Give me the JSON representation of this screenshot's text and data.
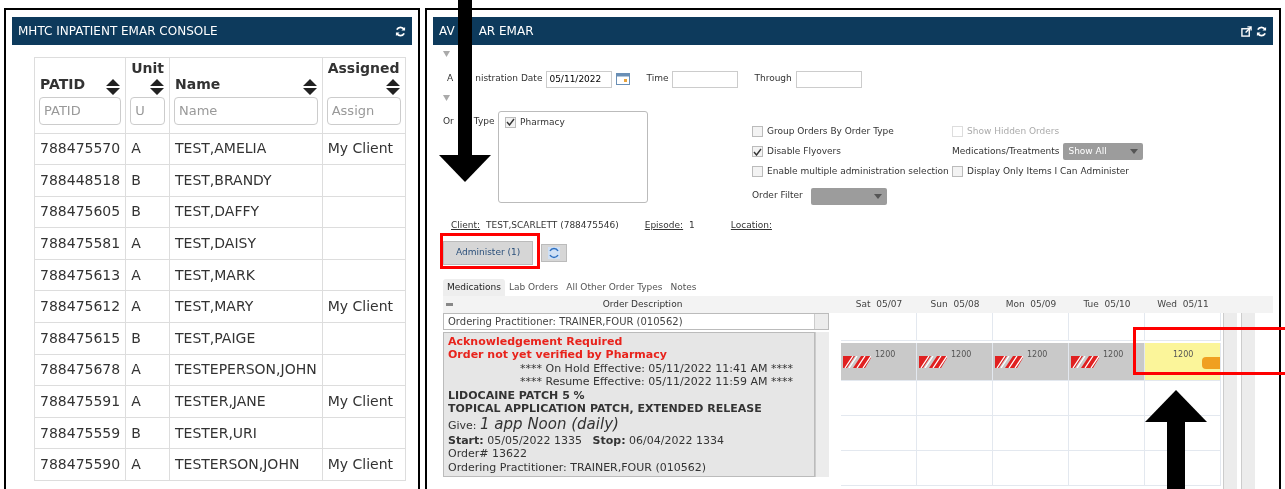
{
  "left_panel": {
    "title": "MHTC INPATIENT EMAR CONSOLE",
    "columns": [
      {
        "label": "PATID",
        "placeholder": "PATID"
      },
      {
        "label": "Unit",
        "placeholder": "U"
      },
      {
        "label": "Name",
        "placeholder": "Name"
      },
      {
        "label": "Assigned",
        "placeholder": "Assign"
      }
    ],
    "rows": [
      [
        "788475570",
        "A",
        "TEST,AMELIA",
        "My Client"
      ],
      [
        "788448518",
        "B",
        "TEST,BRANDY",
        ""
      ],
      [
        "788475605",
        "B",
        "TEST,DAFFY",
        ""
      ],
      [
        "788475581",
        "A",
        "TEST,DAISY",
        ""
      ],
      [
        "788475613",
        "A",
        "TEST,MARK",
        ""
      ],
      [
        "788475612",
        "A",
        "TEST,MARY",
        "My Client"
      ],
      [
        "788475615",
        "B",
        "TEST,PAIGE",
        ""
      ],
      [
        "788475678",
        "A",
        "TESTEPERSON,JOHN",
        ""
      ],
      [
        "788475591",
        "A",
        "TESTER,JANE",
        "My Client"
      ],
      [
        "788475559",
        "B",
        "TESTER,URI",
        ""
      ],
      [
        "788475590",
        "A",
        "TESTERSON,JOHN",
        "My Client"
      ]
    ]
  },
  "right_panel": {
    "title_parts": [
      "AV",
      "AR EMAR"
    ],
    "admin_date_label_parts": [
      "A",
      "nistration Date"
    ],
    "admin_date": "05/11/2022",
    "time_label": "Time",
    "through_label": "Through",
    "order_type_label_parts": [
      "Or",
      "Type"
    ],
    "order_types": [
      {
        "label": "Pharmacy",
        "checked": true
      }
    ],
    "options": [
      {
        "label": "Group Orders By Order Type",
        "checked": false,
        "disabled": false
      },
      {
        "label": "Show Hidden Orders",
        "checked": false,
        "disabled": true
      },
      {
        "label": "Disable Flyovers",
        "checked": true,
        "disabled": false
      },
      {
        "label": "Enable multiple administration selection",
        "checked": false,
        "disabled": false
      },
      {
        "label": "Display Only Items I Can Administer",
        "checked": false,
        "disabled": false
      }
    ],
    "med_treat_label": "Medications/Treatments",
    "med_treat_value": "Show All",
    "order_filter_label": "Order Filter",
    "client_label": "Client:",
    "client": "TEST,SCARLETT (788475546)",
    "episode_label": "Episode:",
    "episode": "1",
    "location_label": "Location:",
    "administer_button": "Administer (1)",
    "tabs": [
      {
        "label": "Medications",
        "selected": true
      },
      {
        "label": "Lab Orders",
        "selected": false
      },
      {
        "label": "All Other Order Types",
        "selected": false
      },
      {
        "label": "Notes",
        "selected": false
      }
    ],
    "description_header": "Order Description",
    "days": [
      "Sat  05/07",
      "Sun  05/08",
      "Mon  05/09",
      "Tue  05/10",
      "Wed  05/11"
    ],
    "previous_order_line": "Ordering Practitioner: TRAINER,FOUR (010562)",
    "order_lines": [
      {
        "kind": "alert",
        "text": "Acknowledgement Required"
      },
      {
        "kind": "alert",
        "text": "Order not yet verified by Pharmacy"
      },
      {
        "kind": "notice",
        "text": "**** On Hold Effective: 05/11/2022 11:41 AM ****"
      },
      {
        "kind": "notice",
        "text": "**** Resume Effective: 05/11/2022 11:59 AM ****"
      },
      {
        "kind": "drug",
        "text": "LIDOCAINE PATCH 5 %"
      },
      {
        "kind": "drug",
        "text": "TOPICAL APPLICATION PATCH, EXTENDED RELEASE"
      },
      {
        "kind": "give",
        "label": "Give:",
        "text": "1 app Noon (daily)"
      },
      {
        "kind": "plain",
        "text": "**Start:** 05/05/2022 1335   **Stop:** 06/04/2022 1334"
      },
      {
        "kind": "plain",
        "text": "Order# 13622"
      },
      {
        "kind": "plain",
        "text": "Ordering Practitioner: TRAINER,FOUR (010562)"
      }
    ],
    "slots": [
      {
        "time": "1200",
        "kind": "missed"
      },
      {
        "time": "1200",
        "kind": "missed"
      },
      {
        "time": "1200",
        "kind": "missed"
      },
      {
        "time": "1200",
        "kind": "missed"
      },
      {
        "time": "1200",
        "kind": "due"
      }
    ]
  }
}
